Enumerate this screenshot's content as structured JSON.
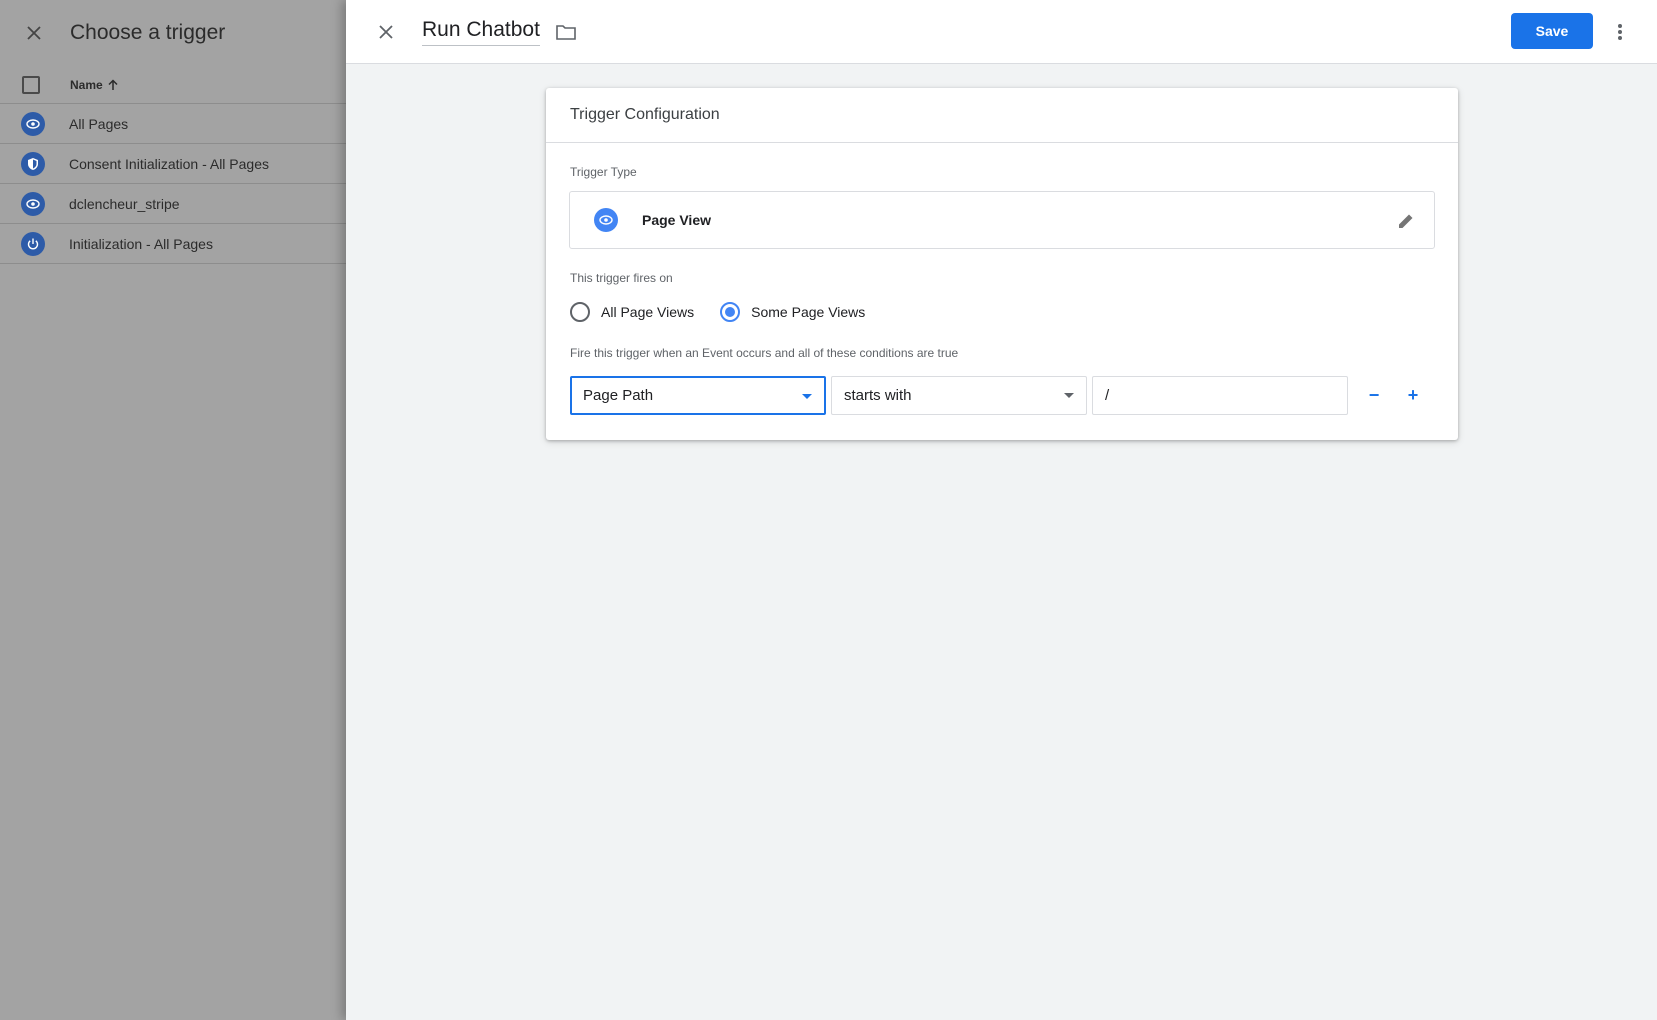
{
  "left_panel": {
    "title": "Choose a trigger",
    "column_header": "Name",
    "rows": [
      {
        "label": "All Pages",
        "icon": "eye-icon"
      },
      {
        "label": "Consent Initialization - All Pages",
        "icon": "shield-icon"
      },
      {
        "label": "dclencheur_stripe",
        "icon": "eye-icon"
      },
      {
        "label": "Initialization - All Pages",
        "icon": "power-icon"
      }
    ]
  },
  "header": {
    "title": "Run Chatbot",
    "save_label": "Save"
  },
  "card": {
    "title": "Trigger Configuration",
    "trigger_type_label": "Trigger Type",
    "trigger_type_value": "Page View",
    "fires_on_label": "This trigger fires on",
    "fires_on_options": [
      {
        "label": "All Page Views",
        "checked": false
      },
      {
        "label": "Some Page Views",
        "checked": true
      }
    ],
    "condition_label": "Fire this trigger when an Event occurs and all of these conditions are true",
    "condition": {
      "variable": "Page Path",
      "operator": "starts with",
      "value": "/"
    },
    "remove_label": "−",
    "add_label": "+"
  },
  "colors": {
    "accent": "#1a73e8",
    "icon_blue": "#4285f4"
  }
}
